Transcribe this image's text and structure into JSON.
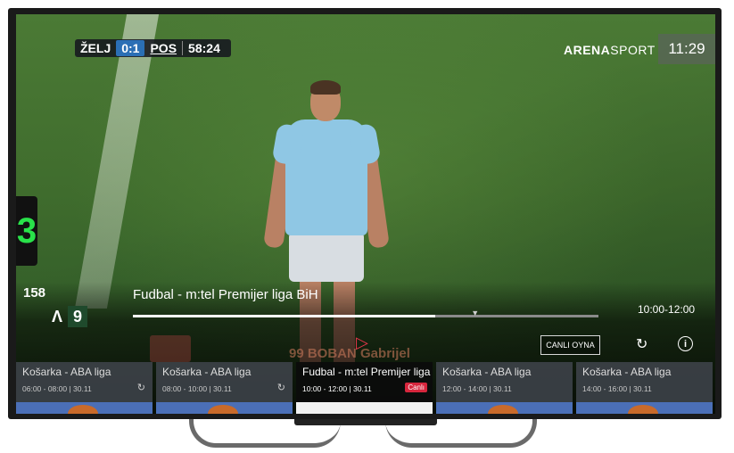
{
  "scoreboard": {
    "team_home": "ŽELJ",
    "score": "0:1",
    "team_away": "POS",
    "match_time": "58:24"
  },
  "broadcaster": {
    "brand_bold": "ARENA",
    "brand_light": "SPORT",
    "clock": "11:29"
  },
  "sub_board_number": "3",
  "channel": {
    "number": "158",
    "logo_letter": "Λ",
    "logo_number": "9"
  },
  "now_playing": {
    "title": "Fudbal - m:tel Premijer liga BiH",
    "time_range": "10:00-12:00",
    "progress": 0.65,
    "background_name": "99 BOBAN Gabrijel"
  },
  "controls": {
    "play_icon": "play-icon",
    "live_label": "CANLI OYNA",
    "restart_icon": "restart-icon",
    "info_label": "i"
  },
  "epg": [
    {
      "title": "Košarka - ABA liga",
      "meta": "06:00 - 08:00 | 30.11",
      "icon": "↻",
      "active": false
    },
    {
      "title": "Košarka - ABA liga",
      "meta": "08:00 - 10:00 | 30.11",
      "icon": "↻",
      "active": false
    },
    {
      "title": "Fudbal - m:tel Premijer liga BiH",
      "meta": "10:00 - 12:00 | 30.11",
      "badge": "Canlı",
      "active": true
    },
    {
      "title": "Košarka - ABA liga",
      "meta": "12:00 - 14:00 | 30.11",
      "active": false
    },
    {
      "title": "Košarka - ABA liga",
      "meta": "14:00 - 16:00 | 30.11",
      "active": false
    }
  ]
}
